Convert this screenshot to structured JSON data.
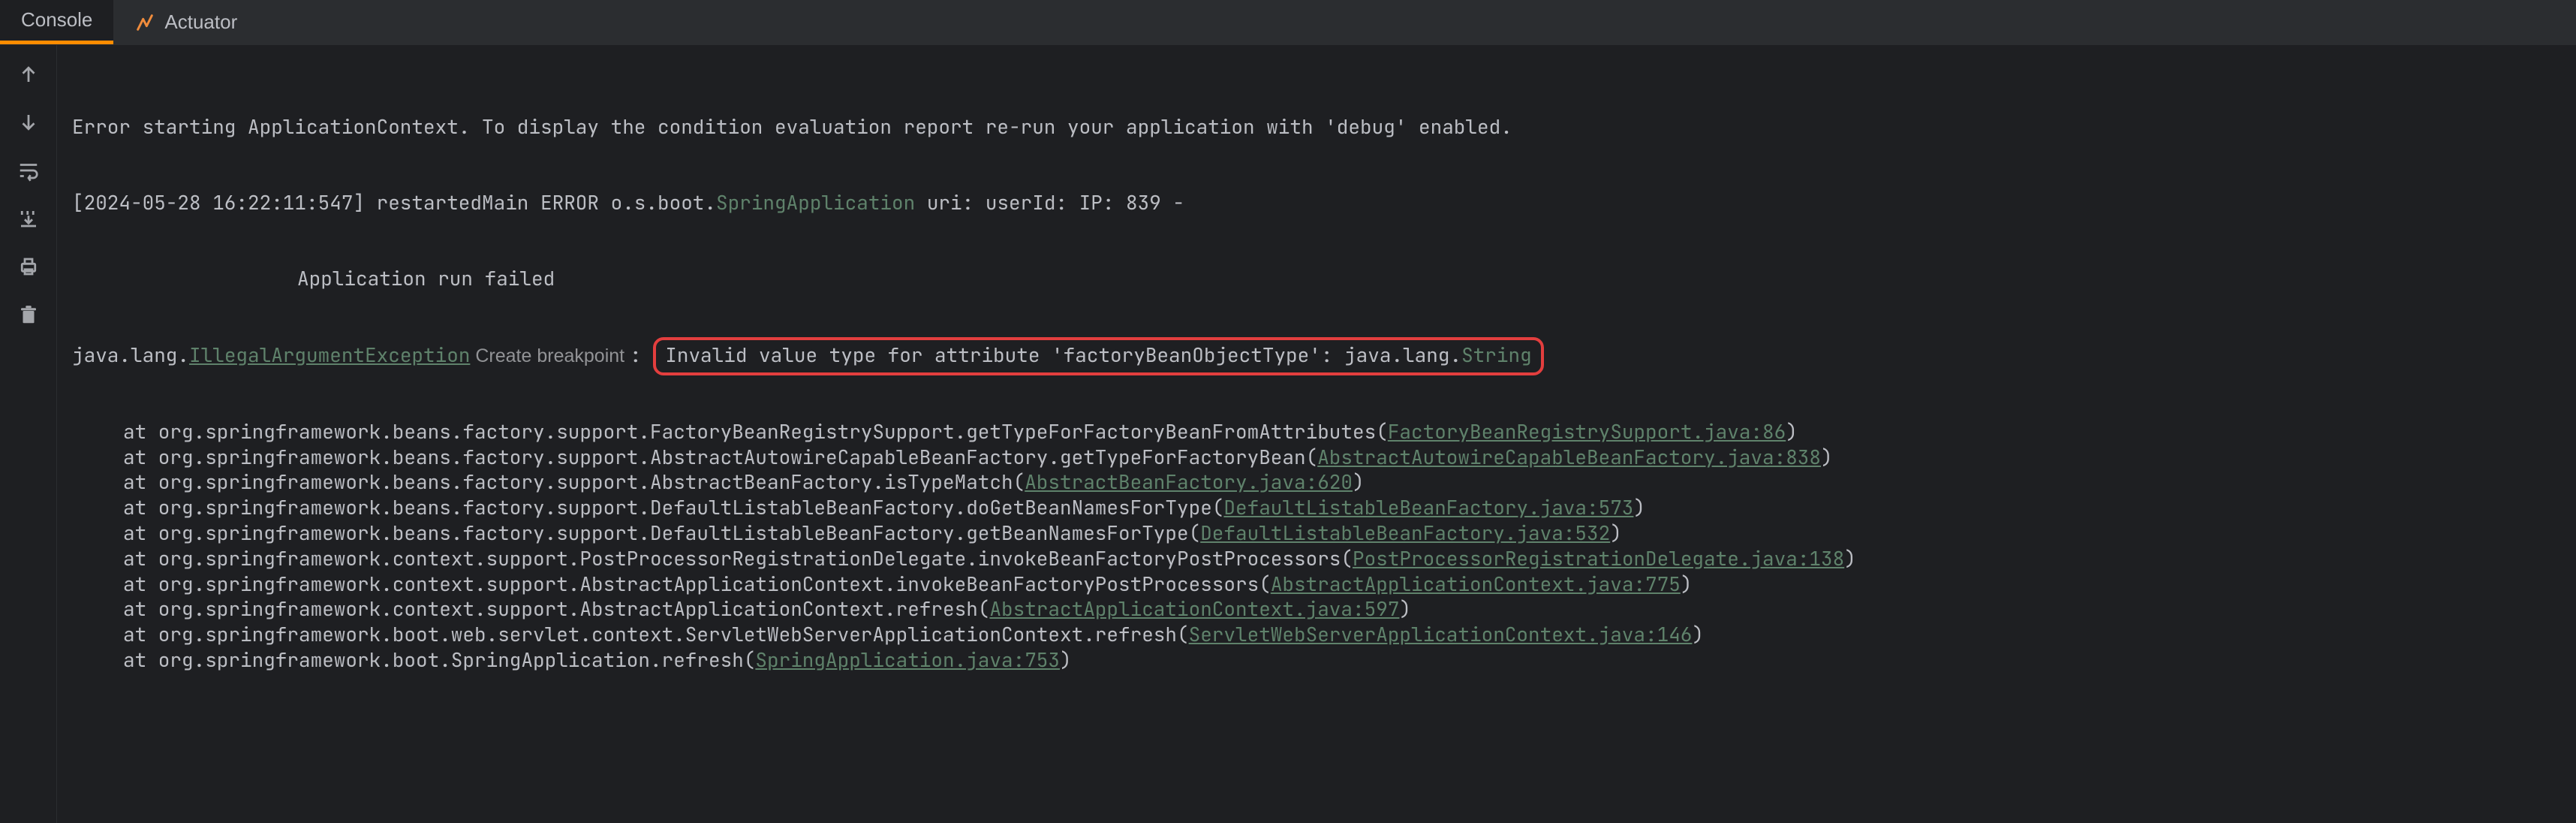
{
  "tabs": [
    {
      "label": "Console",
      "active": true
    },
    {
      "label": "Actuator",
      "active": false
    }
  ],
  "line_error_start": "Error starting ApplicationContext. To display the condition evaluation report re-run your application with 'debug' enabled.",
  "log_ts": "[2024-05-28 16:22:11:547] restartedMain ERROR o.s.boot.",
  "log_spring_app": "SpringApplication",
  "log_tail": " uri: userId: IP: 839 -",
  "app_run_failed": "Application run failed",
  "ex_pkg": "java.lang.",
  "ex_class": "IllegalArgumentException",
  "create_bp": " Create breakpoint ",
  "colon": ": ",
  "ex_msg1": "Invalid value type for attribute 'factoryBeanObjectType': java.lang.",
  "ex_msg_string": "String",
  "st": [
    {
      "pre": "at org.springframework.beans.factory.support.FactoryBeanRegistrySupport.getTypeForFactoryBeanFromAttributes(",
      "link": "FactoryBeanRegistrySupport.java:86",
      "post": ")"
    },
    {
      "pre": "at org.springframework.beans.factory.support.AbstractAutowireCapableBeanFactory.getTypeForFactoryBean(",
      "link": "AbstractAutowireCapableBeanFactory.java:838",
      "post": ")"
    },
    {
      "pre": "at org.springframework.beans.factory.support.AbstractBeanFactory.isTypeMatch(",
      "link": "AbstractBeanFactory.java:620",
      "post": ")"
    },
    {
      "pre": "at org.springframework.beans.factory.support.DefaultListableBeanFactory.doGetBeanNamesForType(",
      "link": "DefaultListableBeanFactory.java:573",
      "post": ")"
    },
    {
      "pre": "at org.springframework.beans.factory.support.DefaultListableBeanFactory.getBeanNamesForType(",
      "link": "DefaultListableBeanFactory.java:532",
      "post": ")"
    },
    {
      "pre": "at org.springframework.context.support.PostProcessorRegistrationDelegate.invokeBeanFactoryPostProcessors(",
      "link": "PostProcessorRegistrationDelegate.java:138",
      "post": ")"
    },
    {
      "pre": "at org.springframework.context.support.AbstractApplicationContext.invokeBeanFactoryPostProcessors(",
      "link": "AbstractApplicationContext.java:775",
      "post": ")"
    },
    {
      "pre": "at org.springframework.context.support.AbstractApplicationContext.refresh(",
      "link": "AbstractApplicationContext.java:597",
      "post": ")"
    },
    {
      "pre": "at org.springframework.boot.web.servlet.context.ServletWebServerApplicationContext.refresh(",
      "link": "ServletWebServerApplicationContext.java:146",
      "post": ")"
    },
    {
      "pre": "at org.springframework.boot.SpringApplication.refresh(",
      "link": "SpringApplication.java:753",
      "post": ")"
    }
  ],
  "gutter_icons": [
    "arrow-up",
    "arrow-down",
    "wrap",
    "layout",
    "print",
    "trash"
  ]
}
